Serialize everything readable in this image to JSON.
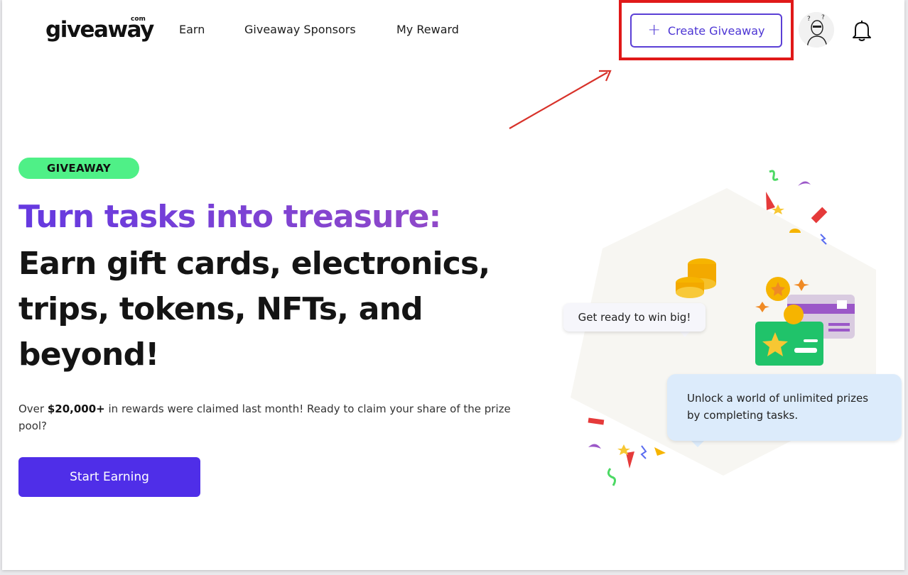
{
  "header": {
    "logo_text": "giveaway",
    "logo_suffix": "com",
    "nav": [
      {
        "label": "Earn"
      },
      {
        "label": "Giveaway Sponsors"
      },
      {
        "label": "My Reward"
      }
    ],
    "create_button": {
      "label": "Create Giveaway",
      "icon": "plus-icon"
    },
    "avatar_icon": "user-avatar",
    "bell_icon": "bell-icon"
  },
  "hero": {
    "badge": "GIVEAWAY",
    "headline_accent": "Turn tasks into treasure:",
    "headline_lines": [
      "Earn gift cards, electronics,",
      "trips, tokens, NFTs, and",
      "beyond!"
    ],
    "subtext_prefix": "Over ",
    "subtext_amount": "$20,000+",
    "subtext_suffix": " in rewards were claimed last month! Ready to claim your share of the prize pool?",
    "cta": "Start Earning"
  },
  "illustration": {
    "bubble_small": "Get ready to win big!",
    "bubble_large": "Unlock a world of unlimited prizes by completing tasks."
  },
  "colors": {
    "accent": "#4f2ee8",
    "badge": "#4ff087",
    "highlight": "#e01919"
  }
}
